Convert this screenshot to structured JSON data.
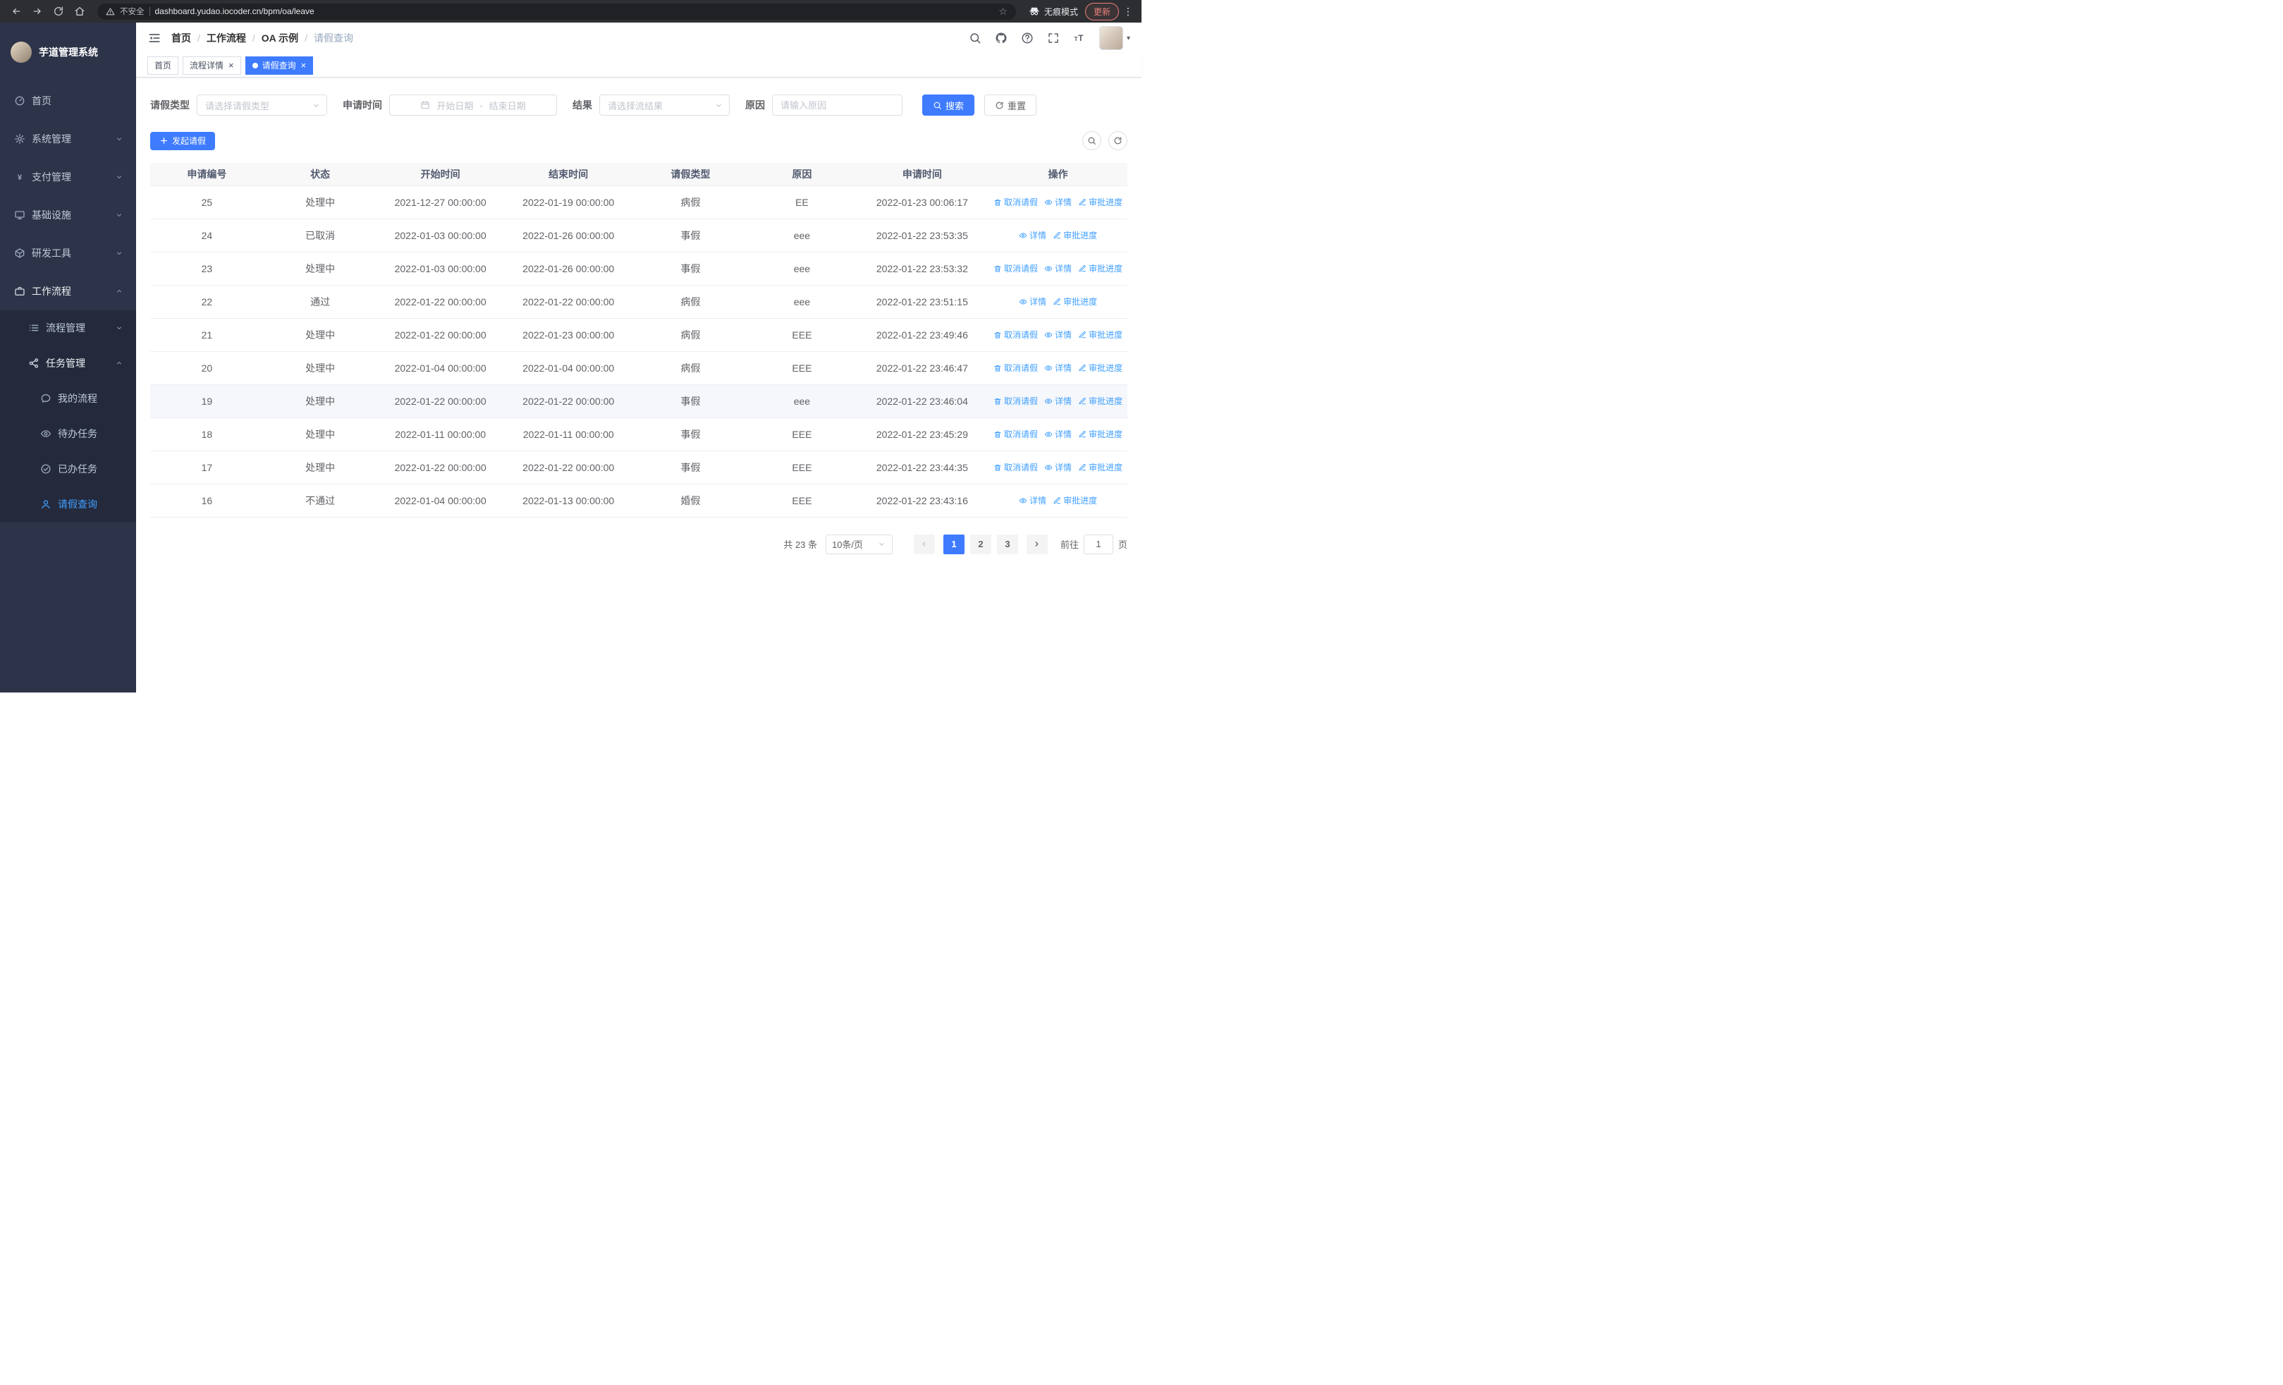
{
  "colors": {
    "primary": "#3e7bff",
    "link": "#41a0ff",
    "menu_active": "#409eff",
    "chrome_bg": "#2d2e31",
    "chrome_pill": "#202124",
    "sidebar_bg": "#2d3348",
    "sidebar_sub_bg": "#242a3c"
  },
  "glyphs": {
    "close": "×",
    "caret_down": "▾",
    "menu_dots": "⋮",
    "star": "☆",
    "breadcrumb_sep": "/"
  },
  "browser": {
    "security_warning": "不安全",
    "url": "dashboard.yudao.iocoder.cn/bpm/oa/leave",
    "incognito_label": "无痕模式",
    "update_label": "更新"
  },
  "app": {
    "logo_title": "芋道管理系统",
    "breadcrumb": [
      "首页",
      "工作流程",
      "OA 示例",
      "请假查询"
    ],
    "tabs": [
      {
        "key": "home",
        "label": "首页",
        "closable": false,
        "active": false
      },
      {
        "key": "process-detail",
        "label": "流程详情",
        "closable": true,
        "active": false
      },
      {
        "key": "leave-query",
        "label": "请假查询",
        "closable": true,
        "active": true
      }
    ]
  },
  "sidebar": {
    "items": [
      {
        "key": "home",
        "label": "首页",
        "icon": "dashboard",
        "level": 1
      },
      {
        "key": "system-management",
        "label": "系统管理",
        "icon": "gear",
        "level": 1,
        "arrow": "down"
      },
      {
        "key": "payment-management",
        "label": "支付管理",
        "icon": "yen",
        "level": 1,
        "arrow": "down"
      },
      {
        "key": "infrastructure",
        "label": "基础设施",
        "icon": "monitor",
        "level": 1,
        "arrow": "down"
      },
      {
        "key": "dev-tools",
        "label": "研发工具",
        "icon": "box",
        "level": 1,
        "arrow": "down"
      },
      {
        "key": "workflow",
        "label": "工作流程",
        "icon": "briefcase",
        "level": 1,
        "arrow": "up",
        "open": true
      },
      {
        "key": "process-management",
        "label": "流程管理",
        "icon": "list",
        "level": 2,
        "arrow": "down"
      },
      {
        "key": "task-management",
        "label": "任务管理",
        "icon": "share",
        "level": 2,
        "arrow": "up",
        "open": true
      },
      {
        "key": "my-process",
        "label": "我的流程",
        "icon": "chat",
        "level": 3
      },
      {
        "key": "todo-tasks",
        "label": "待办任务",
        "icon": "eye",
        "level": 3
      },
      {
        "key": "done-tasks",
        "label": "已办任务",
        "icon": "check",
        "level": 3
      },
      {
        "key": "leave-query",
        "label": "请假查询",
        "icon": "user",
        "level": 3,
        "active": true
      }
    ]
  },
  "filters": {
    "leave_type_label": "请假类型",
    "leave_type_placeholder": "请选择请假类型",
    "apply_time_label": "申请时间",
    "date_start_placeholder": "开始日期",
    "date_separator": "-",
    "date_end_placeholder": "结束日期",
    "result_label": "结果",
    "result_placeholder": "请选择流结果",
    "reason_label": "原因",
    "reason_placeholder": "请输入原因",
    "search_label": "搜索",
    "reset_label": "重置"
  },
  "toolbar": {
    "create_label": "发起请假"
  },
  "table": {
    "columns": [
      "申请编号",
      "状态",
      "开始时间",
      "结束时间",
      "请假类型",
      "原因",
      "申请时间",
      "操作"
    ],
    "action_labels": {
      "cancel": "取消请假",
      "detail": "详情",
      "progress": "审批进度"
    },
    "rows": [
      {
        "id": "25",
        "status": "处理中",
        "start": "2021-12-27 00:00:00",
        "end": "2022-01-19 00:00:00",
        "type": "病假",
        "reason": "EE",
        "applied": "2022-01-23 00:06:17",
        "actions": [
          "cancel",
          "detail",
          "progress"
        ]
      },
      {
        "id": "24",
        "status": "已取消",
        "start": "2022-01-03 00:00:00",
        "end": "2022-01-26 00:00:00",
        "type": "事假",
        "reason": "eee",
        "applied": "2022-01-22 23:53:35",
        "actions": [
          "detail",
          "progress"
        ]
      },
      {
        "id": "23",
        "status": "处理中",
        "start": "2022-01-03 00:00:00",
        "end": "2022-01-26 00:00:00",
        "type": "事假",
        "reason": "eee",
        "applied": "2022-01-22 23:53:32",
        "actions": [
          "cancel",
          "detail",
          "progress"
        ]
      },
      {
        "id": "22",
        "status": "通过",
        "start": "2022-01-22 00:00:00",
        "end": "2022-01-22 00:00:00",
        "type": "病假",
        "reason": "eee",
        "applied": "2022-01-22 23:51:15",
        "actions": [
          "detail",
          "progress"
        ]
      },
      {
        "id": "21",
        "status": "处理中",
        "start": "2022-01-22 00:00:00",
        "end": "2022-01-23 00:00:00",
        "type": "病假",
        "reason": "EEE",
        "applied": "2022-01-22 23:49:46",
        "actions": [
          "cancel",
          "detail",
          "progress"
        ]
      },
      {
        "id": "20",
        "status": "处理中",
        "start": "2022-01-04 00:00:00",
        "end": "2022-01-04 00:00:00",
        "type": "病假",
        "reason": "EEE",
        "applied": "2022-01-22 23:46:47",
        "actions": [
          "cancel",
          "detail",
          "progress"
        ]
      },
      {
        "id": "19",
        "status": "处理中",
        "start": "2022-01-22 00:00:00",
        "end": "2022-01-22 00:00:00",
        "type": "事假",
        "reason": "eee",
        "applied": "2022-01-22 23:46:04",
        "actions": [
          "cancel",
          "detail",
          "progress"
        ],
        "hovered": true
      },
      {
        "id": "18",
        "status": "处理中",
        "start": "2022-01-11 00:00:00",
        "end": "2022-01-11 00:00:00",
        "type": "事假",
        "reason": "EEE",
        "applied": "2022-01-22 23:45:29",
        "actions": [
          "cancel",
          "detail",
          "progress"
        ]
      },
      {
        "id": "17",
        "status": "处理中",
        "start": "2022-01-22 00:00:00",
        "end": "2022-01-22 00:00:00",
        "type": "事假",
        "reason": "EEE",
        "applied": "2022-01-22 23:44:35",
        "actions": [
          "cancel",
          "detail",
          "progress"
        ]
      },
      {
        "id": "16",
        "status": "不通过",
        "start": "2022-01-04 00:00:00",
        "end": "2022-01-13 00:00:00",
        "type": "婚假",
        "reason": "EEE",
        "applied": "2022-01-22 23:43:16",
        "actions": [
          "detail",
          "progress"
        ]
      }
    ]
  },
  "pagination": {
    "total_text": "共 23 条",
    "page_size": "10条/页",
    "pages": [
      "1",
      "2",
      "3"
    ],
    "active_page": "1",
    "goto_label": "前往",
    "goto_value": "1",
    "goto_suffix": "页"
  }
}
